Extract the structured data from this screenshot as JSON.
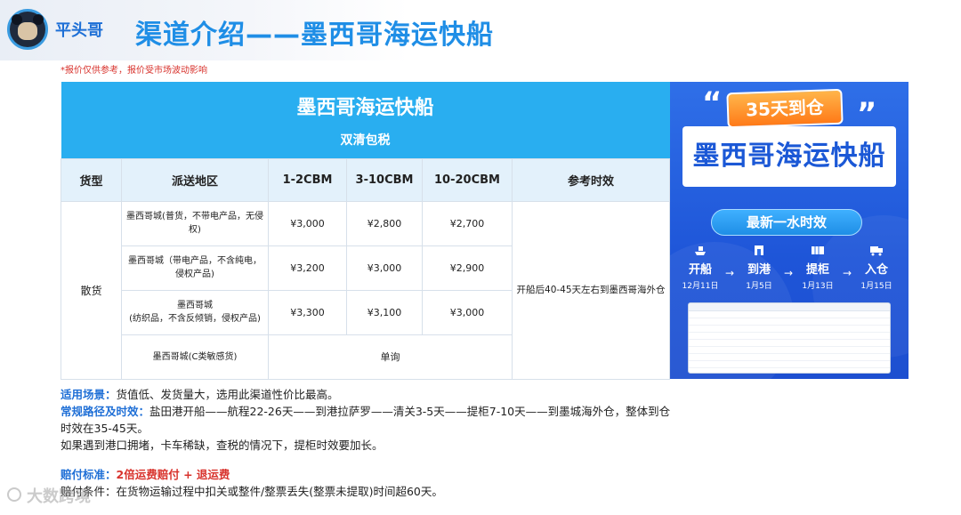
{
  "header": {
    "brand": "平头哥",
    "title": "渠道介绍——墨西哥海运快船"
  },
  "note": "*报价仅供参考，报价受市场波动影响",
  "table": {
    "banner_title": "墨西哥海运快船",
    "banner_subtitle": "双清包税",
    "headers": [
      "货型",
      "派送地区",
      "1-2CBM",
      "3-10CBM",
      "10-20CBM",
      "参考时效"
    ],
    "cargo_type": "散货",
    "reference_time": "开船后40-45天左右到墨西哥海外仓",
    "rows": [
      {
        "region": "墨西哥城(普货，不带电产品，无侵权)",
        "p1": "¥3,000",
        "p2": "¥2,800",
        "p3": "¥2,700"
      },
      {
        "region": "墨西哥城（带电产品，不含纯电，侵权产品)",
        "p1": "¥3,200",
        "p2": "¥3,000",
        "p3": "¥2,900"
      },
      {
        "region": "墨西哥城\n(纺织品，不含反倾销，侵权产品)",
        "p1": "¥3,300",
        "p2": "¥3,100",
        "p3": "¥3,000"
      }
    ],
    "last_row": {
      "region": "墨西哥城(C类敏感货)",
      "price": "单询"
    }
  },
  "poster": {
    "badge": "35天到仓",
    "title": "墨西哥海运快船",
    "pill": "最新一水时效",
    "steps": [
      {
        "label": "开船",
        "date": "12月11日"
      },
      {
        "label": "到港",
        "date": "1月5日"
      },
      {
        "label": "提柜",
        "date": "1月13日"
      },
      {
        "label": "入仓",
        "date": "1月15日"
      }
    ],
    "arrow": "→"
  },
  "info": {
    "scene_label": "适用场景：",
    "scene_text": "货值低、发货量大，选用此渠道性价比最高。",
    "route_label": "常规路径及时效：",
    "route_text": "盐田港开船——航程22-26天——到港拉萨罗——清关3-5天——提柜7-10天——到墨城海外仓，整体到仓",
    "route_text2": "时效在35-45天。",
    "delay_text": "如果遇到港口拥堵，卡车稀缺，查税的情况下，提柜时效要加长。",
    "comp_label": "赔付标准：",
    "comp_text": "2倍运费赔付 + 退运费",
    "cond_label": "赔付条件：",
    "cond_text": "在货物运输过程中扣关或整件/整票丢失(整票未提取)时间超60天。"
  },
  "watermark": "大数跨境"
}
